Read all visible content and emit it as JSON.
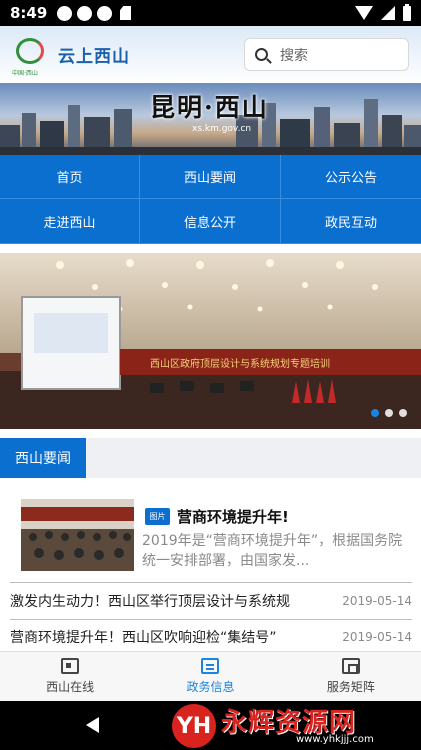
{
  "status_bar": {
    "time": "8:49"
  },
  "header": {
    "logo_sub": "中国·西山",
    "app_title": "云上西山",
    "search_placeholder": "搜索"
  },
  "banner": {
    "title": "昆明·西山",
    "url": "xs.km.gov.cn"
  },
  "nav": {
    "items": [
      {
        "label": "首页"
      },
      {
        "label": "西山要闻"
      },
      {
        "label": "公示公告"
      },
      {
        "label": "走进西山"
      },
      {
        "label": "信息公开"
      },
      {
        "label": "政民互动"
      }
    ]
  },
  "carousel": {
    "slide_caption": "西山区政府顶层设计与系统规划专题培训",
    "total_dots": 3,
    "active_dot": 1
  },
  "section": {
    "title": "西山要闻"
  },
  "featured": {
    "badge": "图片",
    "title": "营商环境提升年!",
    "summary": "2019年是“营商环境提升年”，根据国务院统一安排部署，由国家发..."
  },
  "news": [
    {
      "title": "激发内生动力！西山区举行顶层设计与系统规",
      "date": "2019-05-14"
    },
    {
      "title": "营商环境提升年！西山区吹响迎检“集结号”",
      "date": "2019-05-14"
    }
  ],
  "tab_bar": {
    "tabs": [
      {
        "label": "西山在线",
        "icon": "news-icon"
      },
      {
        "label": "政务信息",
        "icon": "document-icon"
      },
      {
        "label": "服务矩阵",
        "icon": "store-icon"
      }
    ],
    "active_index": 1
  },
  "watermark": {
    "text": "永辉资源网",
    "url": "www.yhkjjj.com"
  },
  "colors": {
    "primary": "#0b6fcf",
    "accent": "#1a84e0",
    "watermark": "#d9231f"
  }
}
